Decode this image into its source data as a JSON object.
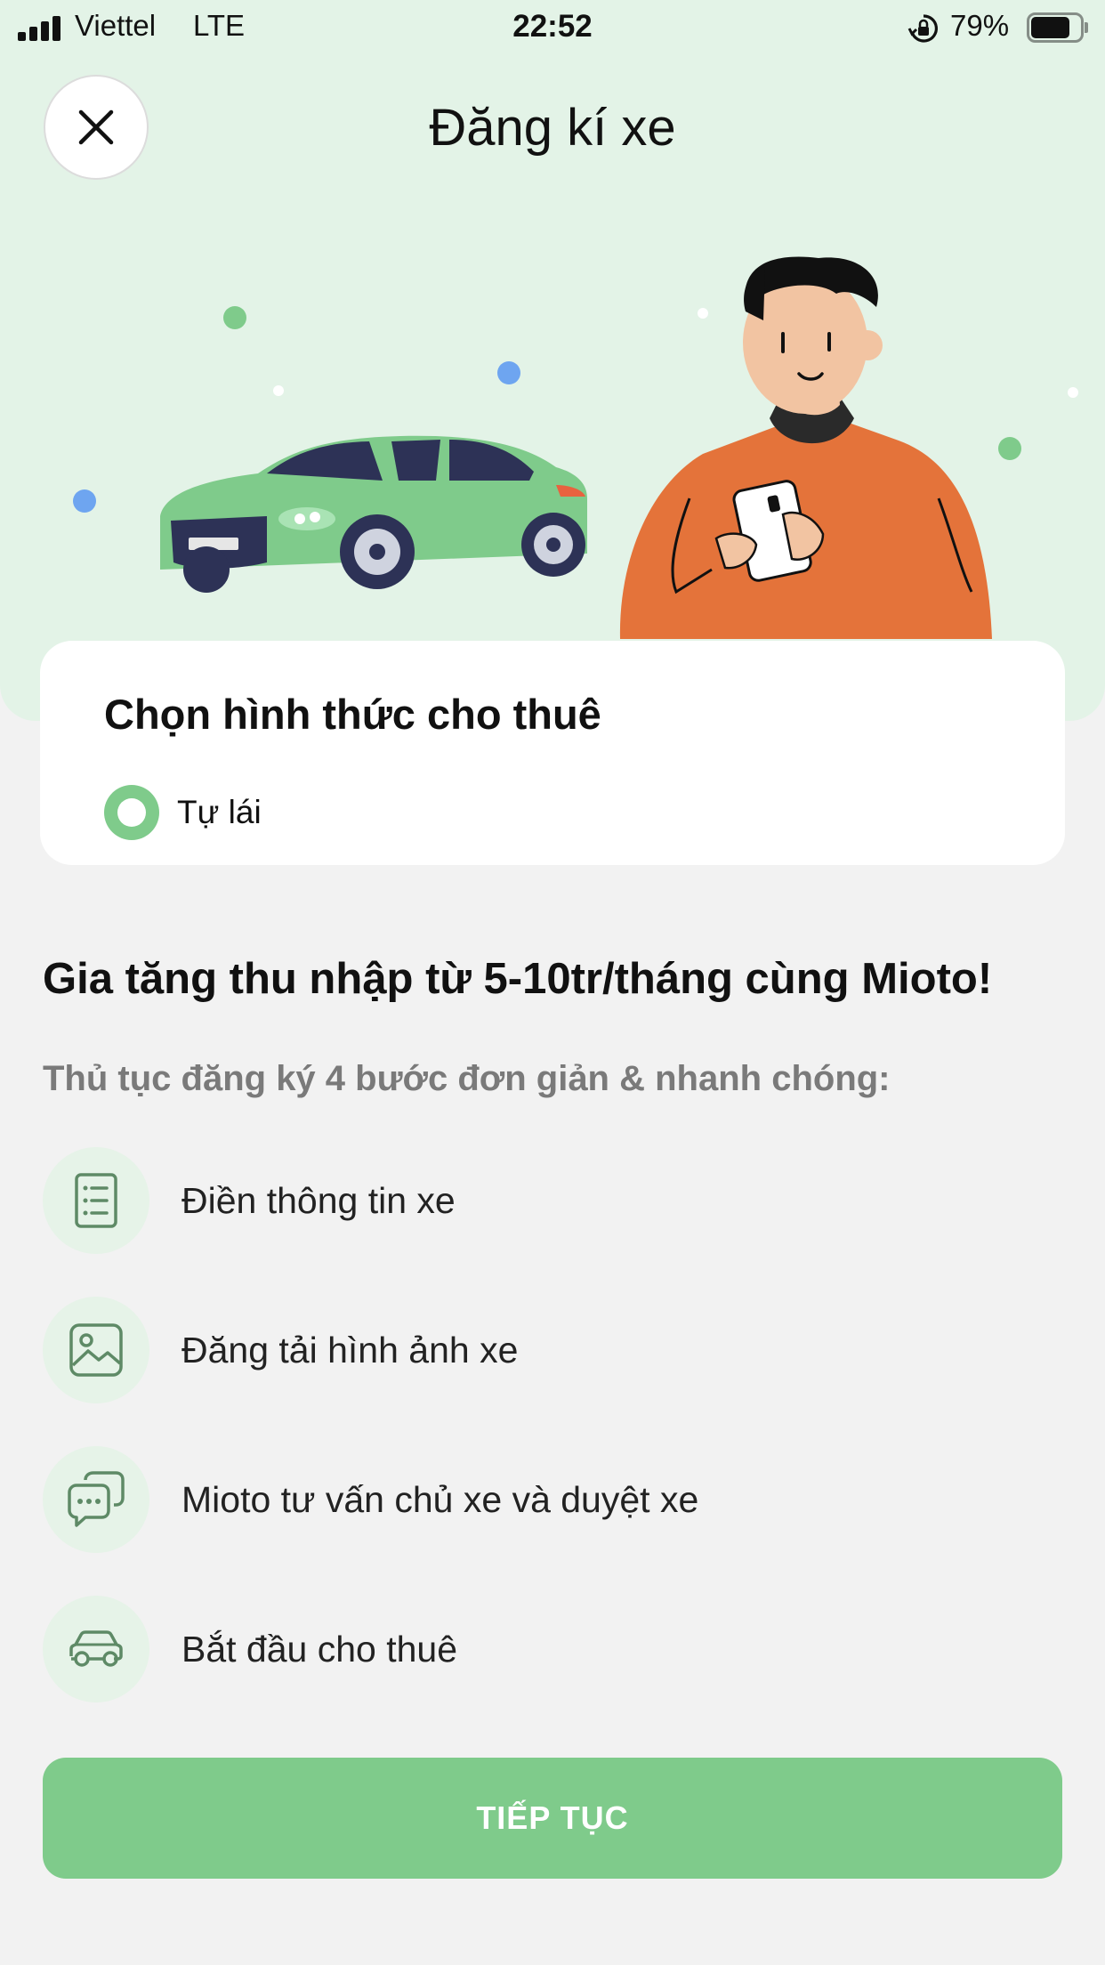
{
  "status_bar": {
    "carrier": "Viettel",
    "network": "LTE",
    "time": "22:52",
    "battery": "79%",
    "battery_level": 0.79
  },
  "header": {
    "title": "Đăng kí xe",
    "close_icon": "close-icon"
  },
  "rental_card": {
    "title": "Chọn hình thức cho thuê",
    "options": [
      {
        "label": "Tự lái",
        "selected": true
      }
    ]
  },
  "promo": {
    "title": "Gia tăng thu nhập từ 5-10tr/tháng cùng Mioto!",
    "subtitle": "Thủ tục đăng ký 4 bước đơn giản & nhanh chóng:"
  },
  "steps": [
    {
      "label": "Điền thông tin xe",
      "icon": "document-list-icon"
    },
    {
      "label": "Đăng tải hình ảnh xe",
      "icon": "image-icon"
    },
    {
      "label": "Mioto tư vấn chủ xe và duyệt xe",
      "icon": "chat-bubbles-icon"
    },
    {
      "label": "Bắt đầu cho thuê",
      "icon": "car-icon"
    }
  ],
  "continue_button": {
    "label": "TIẾP TỤC"
  },
  "colors": {
    "accent_green": "#7fcb8b",
    "hero_background": "#e3f3e7",
    "icon_circle": "#e6f3e8",
    "page_background": "#f2f2f2"
  }
}
